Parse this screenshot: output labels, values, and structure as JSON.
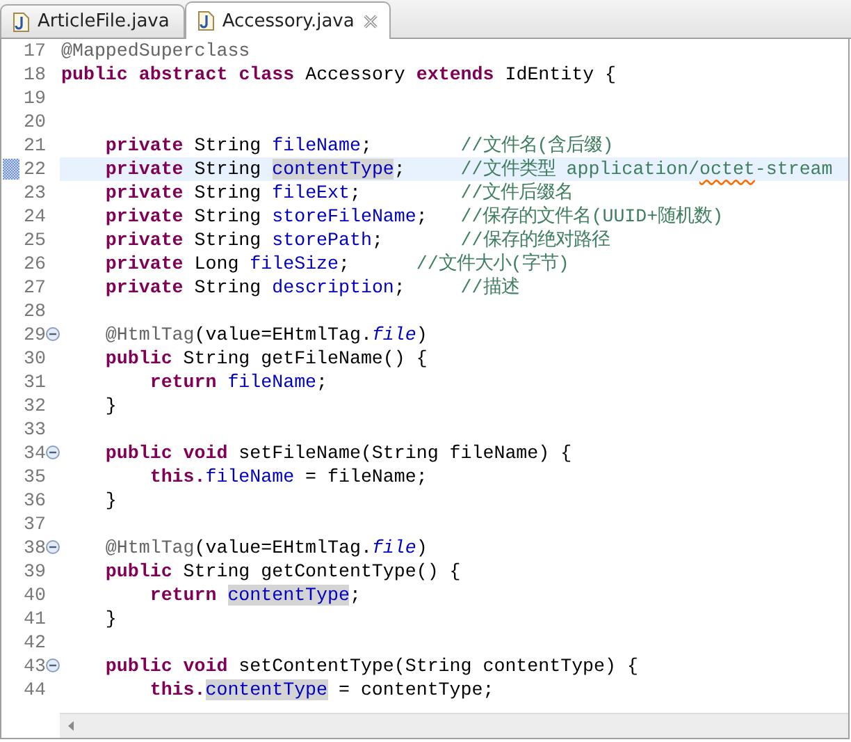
{
  "tabs": [
    {
      "label": "ArticleFile.java",
      "selected": false,
      "closable": false
    },
    {
      "label": "Accessory.java",
      "selected": true,
      "closable": true
    }
  ],
  "editor": {
    "lines": [
      {
        "number": "17",
        "tokens": [
          {
            "kind": "annotation",
            "text": "@MappedSuperclass"
          }
        ]
      },
      {
        "number": "18",
        "tokens": [
          {
            "kind": "keyword",
            "text": "public"
          },
          {
            "kind": "keyword",
            "text": " abstract"
          },
          {
            "kind": "keyword",
            "text": " class"
          },
          {
            "kind": "plain",
            "text": " Accessory "
          },
          {
            "kind": "keyword",
            "text": "extends"
          },
          {
            "kind": "plain",
            "text": " IdEntity {"
          }
        ]
      },
      {
        "number": "19"
      },
      {
        "number": "20"
      },
      {
        "number": "21",
        "tokens": [
          {
            "kind": "keyword",
            "text": "    private"
          },
          {
            "kind": "plain",
            "text": " String "
          },
          {
            "kind": "field",
            "text": "fileName"
          },
          {
            "kind": "plain",
            "text": ";        "
          },
          {
            "kind": "comment",
            "text": "//文件名(含后缀)"
          }
        ]
      },
      {
        "number": "22",
        "current": true,
        "marker": true,
        "tokens": [
          {
            "kind": "keyword",
            "text": "    private"
          },
          {
            "kind": "plain",
            "text": " String "
          },
          {
            "kind": "field",
            "text": "contentType",
            "highlighted": true
          },
          {
            "kind": "plain",
            "text": ";     "
          },
          {
            "kind": "comment",
            "text": "//文件类型 application/"
          },
          {
            "kind": "comment",
            "text": "octet",
            "misspelled": true
          },
          {
            "kind": "comment",
            "text": "-stream"
          }
        ]
      },
      {
        "number": "23",
        "tokens": [
          {
            "kind": "keyword",
            "text": "    private"
          },
          {
            "kind": "plain",
            "text": " String "
          },
          {
            "kind": "field",
            "text": "fileExt"
          },
          {
            "kind": "plain",
            "text": ";         "
          },
          {
            "kind": "comment",
            "text": "//文件后缀名"
          }
        ]
      },
      {
        "number": "24",
        "tokens": [
          {
            "kind": "keyword",
            "text": "    private"
          },
          {
            "kind": "plain",
            "text": " String "
          },
          {
            "kind": "field",
            "text": "storeFileName"
          },
          {
            "kind": "plain",
            "text": ";   "
          },
          {
            "kind": "comment",
            "text": "//保存的文件名(UUID+随机数)"
          }
        ]
      },
      {
        "number": "25",
        "tokens": [
          {
            "kind": "keyword",
            "text": "    private"
          },
          {
            "kind": "plain",
            "text": " String "
          },
          {
            "kind": "field",
            "text": "storePath"
          },
          {
            "kind": "plain",
            "text": ";       "
          },
          {
            "kind": "comment",
            "text": "//保存的绝对路径"
          }
        ]
      },
      {
        "number": "26",
        "tokens": [
          {
            "kind": "keyword",
            "text": "    private"
          },
          {
            "kind": "plain",
            "text": " Long "
          },
          {
            "kind": "field",
            "text": "fileSize"
          },
          {
            "kind": "plain",
            "text": ";      "
          },
          {
            "kind": "comment",
            "text": "//文件大小(字节)"
          }
        ]
      },
      {
        "number": "27",
        "tokens": [
          {
            "kind": "keyword",
            "text": "    private"
          },
          {
            "kind": "plain",
            "text": " String "
          },
          {
            "kind": "field",
            "text": "description"
          },
          {
            "kind": "plain",
            "text": ";     "
          },
          {
            "kind": "comment",
            "text": "//描述"
          }
        ]
      },
      {
        "number": "28"
      },
      {
        "number": "29",
        "foldable": true,
        "tokens": [
          {
            "kind": "annotation",
            "text": "    @HtmlTag"
          },
          {
            "kind": "plain",
            "text": "(value=EHtmlTag."
          },
          {
            "kind": "static",
            "text": "file"
          },
          {
            "kind": "plain",
            "text": ")"
          }
        ]
      },
      {
        "number": "30",
        "tokens": [
          {
            "kind": "keyword",
            "text": "    public"
          },
          {
            "kind": "plain",
            "text": " String getFileName() {"
          }
        ]
      },
      {
        "number": "31",
        "tokens": [
          {
            "kind": "keyword",
            "text": "        return"
          },
          {
            "kind": "field",
            "text": " fileName"
          },
          {
            "kind": "plain",
            "text": ";"
          }
        ]
      },
      {
        "number": "32",
        "tokens": [
          {
            "kind": "plain",
            "text": "    }"
          }
        ]
      },
      {
        "number": "33"
      },
      {
        "number": "34",
        "foldable": true,
        "tokens": [
          {
            "kind": "keyword",
            "text": "    public"
          },
          {
            "kind": "keyword",
            "text": " void"
          },
          {
            "kind": "plain",
            "text": " setFileName(String fileName) {"
          }
        ]
      },
      {
        "number": "35",
        "tokens": [
          {
            "kind": "keyword",
            "text": "        this."
          },
          {
            "kind": "field",
            "text": "fileName"
          },
          {
            "kind": "plain",
            "text": " = fileName;"
          }
        ]
      },
      {
        "number": "36",
        "tokens": [
          {
            "kind": "plain",
            "text": "    }"
          }
        ]
      },
      {
        "number": "37"
      },
      {
        "number": "38",
        "foldable": true,
        "tokens": [
          {
            "kind": "annotation",
            "text": "    @HtmlTag"
          },
          {
            "kind": "plain",
            "text": "(value=EHtmlTag."
          },
          {
            "kind": "static",
            "text": "file"
          },
          {
            "kind": "plain",
            "text": ")"
          }
        ]
      },
      {
        "number": "39",
        "tokens": [
          {
            "kind": "keyword",
            "text": "    public"
          },
          {
            "kind": "plain",
            "text": " String getContentType() {"
          }
        ]
      },
      {
        "number": "40",
        "tokens": [
          {
            "kind": "keyword",
            "text": "        return "
          },
          {
            "kind": "field",
            "text": "contentType",
            "highlighted": true
          },
          {
            "kind": "plain",
            "text": ";"
          }
        ]
      },
      {
        "number": "41",
        "tokens": [
          {
            "kind": "plain",
            "text": "    }"
          }
        ]
      },
      {
        "number": "42"
      },
      {
        "number": "43",
        "foldable": true,
        "tokens": [
          {
            "kind": "keyword",
            "text": "    public"
          },
          {
            "kind": "keyword",
            "text": " void"
          },
          {
            "kind": "plain",
            "text": " setContentType(String contentType) {"
          }
        ]
      },
      {
        "number": "44",
        "tokens": [
          {
            "kind": "keyword",
            "text": "        this."
          },
          {
            "kind": "field",
            "text": "contentType",
            "highlighted": true
          },
          {
            "kind": "plain",
            "text": " = contentType;"
          }
        ]
      }
    ]
  }
}
